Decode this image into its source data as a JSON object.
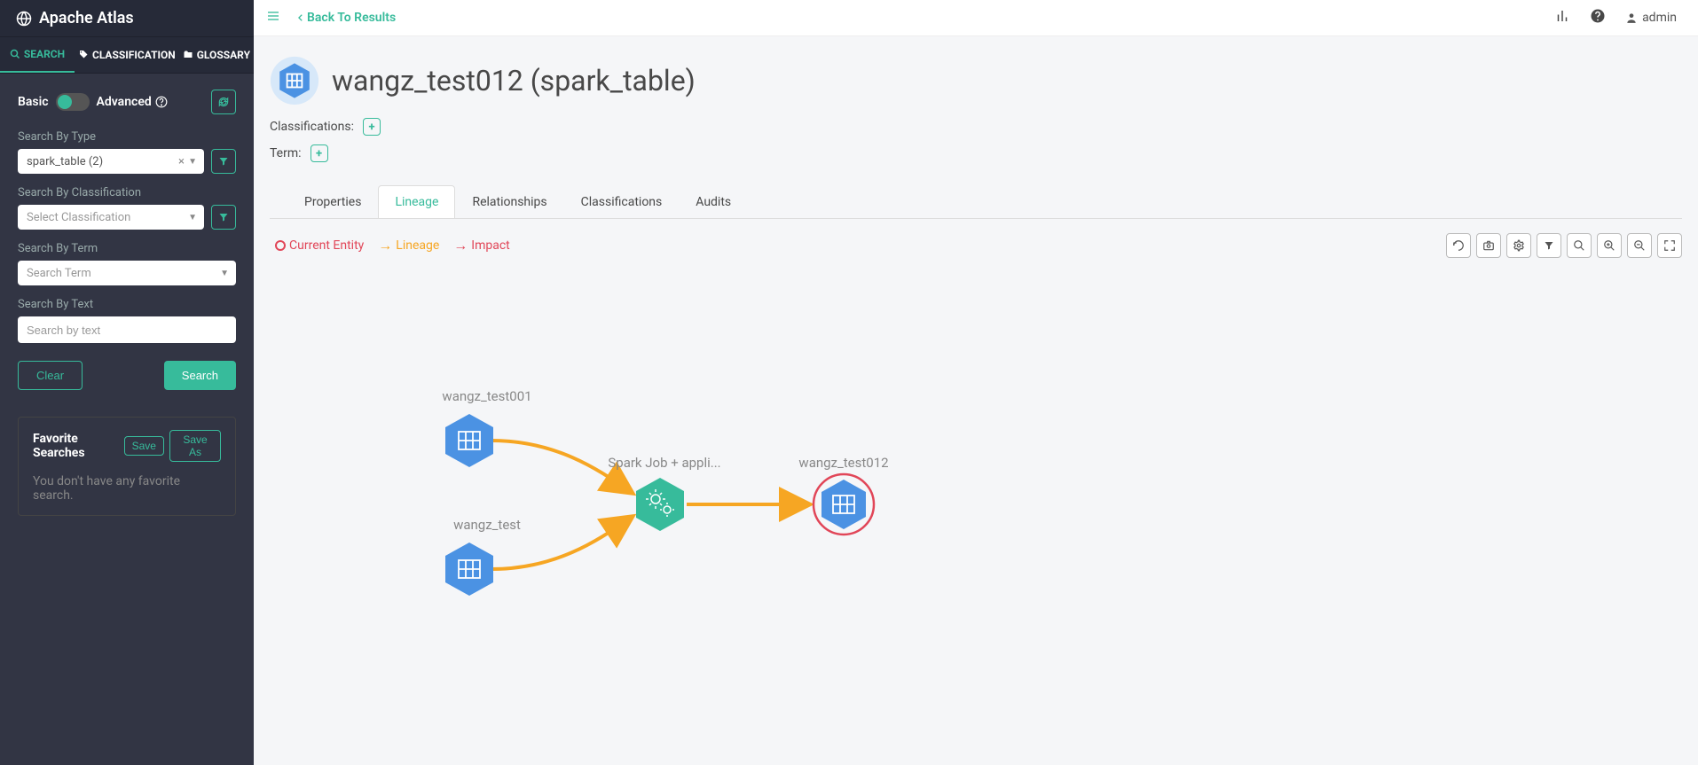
{
  "brand": "Apache Atlas",
  "sidebarTabs": {
    "search": "SEARCH",
    "classification": "CLASSIFICATION",
    "glossary": "GLOSSARY"
  },
  "searchMode": {
    "basic": "Basic",
    "advanced": "Advanced"
  },
  "searchLabels": {
    "byType": "Search By Type",
    "byClass": "Search By Classification",
    "byTerm": "Search By Term",
    "byText": "Search By Text"
  },
  "searchValues": {
    "type": "spark_table (2)",
    "classPlaceholder": "Select Classification",
    "termPlaceholder": "Search Term",
    "textPlaceholder": "Search by text"
  },
  "buttons": {
    "clear": "Clear",
    "search": "Search",
    "save": "Save",
    "saveAs": "Save As"
  },
  "favorites": {
    "title": "Favorite Searches",
    "empty": "You don't have any favorite search."
  },
  "topbar": {
    "back": "Back To Results",
    "admin": "admin"
  },
  "entity": {
    "title": "wangz_test012 (spark_table)",
    "classLabel": "Classifications:",
    "termLabel": "Term:"
  },
  "detailTabs": {
    "properties": "Properties",
    "lineage": "Lineage",
    "relationships": "Relationships",
    "classifications": "Classifications",
    "audits": "Audits"
  },
  "legend": {
    "current": "Current Entity",
    "lineage": "Lineage",
    "impact": "Impact"
  },
  "nodes": {
    "n1": "wangz_test001",
    "n2": "wangz_test",
    "proc": "Spark Job + appli...",
    "out": "wangz_test012"
  }
}
